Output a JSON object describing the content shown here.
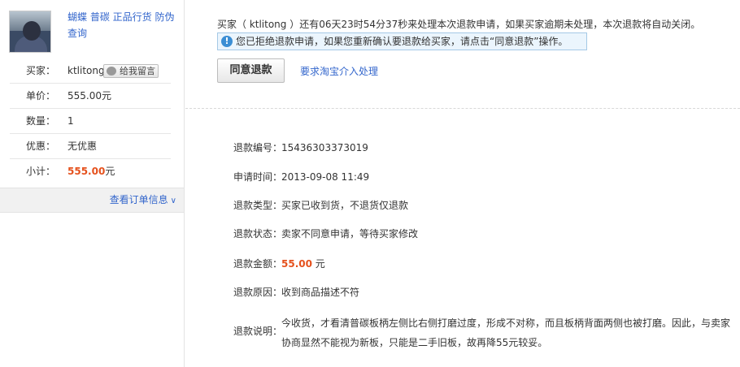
{
  "product": {
    "title": "蝴蝶 普碳 正品行货 防伪查询"
  },
  "sidebar": {
    "buyer_label": "买家：",
    "buyer_name": "ktlitong",
    "message_button": "给我留言",
    "unit_price_label": "单价：",
    "unit_price": "555.00元",
    "quantity_label": "数量：",
    "quantity": "1",
    "discount_label": "优惠：",
    "discount": "无优惠",
    "subtotal_label": "小计：",
    "subtotal_amount": "555.00",
    "subtotal_unit": "元",
    "view_order": "查看订单信息"
  },
  "notice": {
    "text": "买家（ ktlitong ）还有06天23时54分37秒来处理本次退款申请，如果买家逾期未处理，本次退款将自动关闭。",
    "tip": "您已拒绝退款申请，如果您重新确认要退款给买家，请点击“同意退款”操作。"
  },
  "actions": {
    "agree_button": "同意退款",
    "intervene_link": "要求淘宝介入处理"
  },
  "details": {
    "refund_id_label": "退款编号：",
    "refund_id": "15436303373019",
    "apply_time_label": "申请时间：",
    "apply_time": "2013-09-08 11:49",
    "refund_type_label": "退款类型：",
    "refund_type": "买家已收到货，不退货仅退款",
    "status_label": "退款状态：",
    "status": "卖家不同意申请，等待买家修改",
    "amount_label": "退款金额：",
    "amount": "55.00",
    "amount_unit": "元",
    "reason_label": "退款原因：",
    "reason": "收到商品描述不符",
    "description_label": "退款说明：",
    "description": "今收货，才看清普碳板柄左侧比右侧打磨过度，形成不对称，而且板柄背面两侧也被打磨。因此，与卖家协商显然不能视为新板，只能是二手旧板，故再降55元较妥。"
  },
  "colors": {
    "link": "#3366cc",
    "price": "#e5511d",
    "tip_border": "#a5c9e6",
    "tip_bg": "#ebf5fd"
  }
}
